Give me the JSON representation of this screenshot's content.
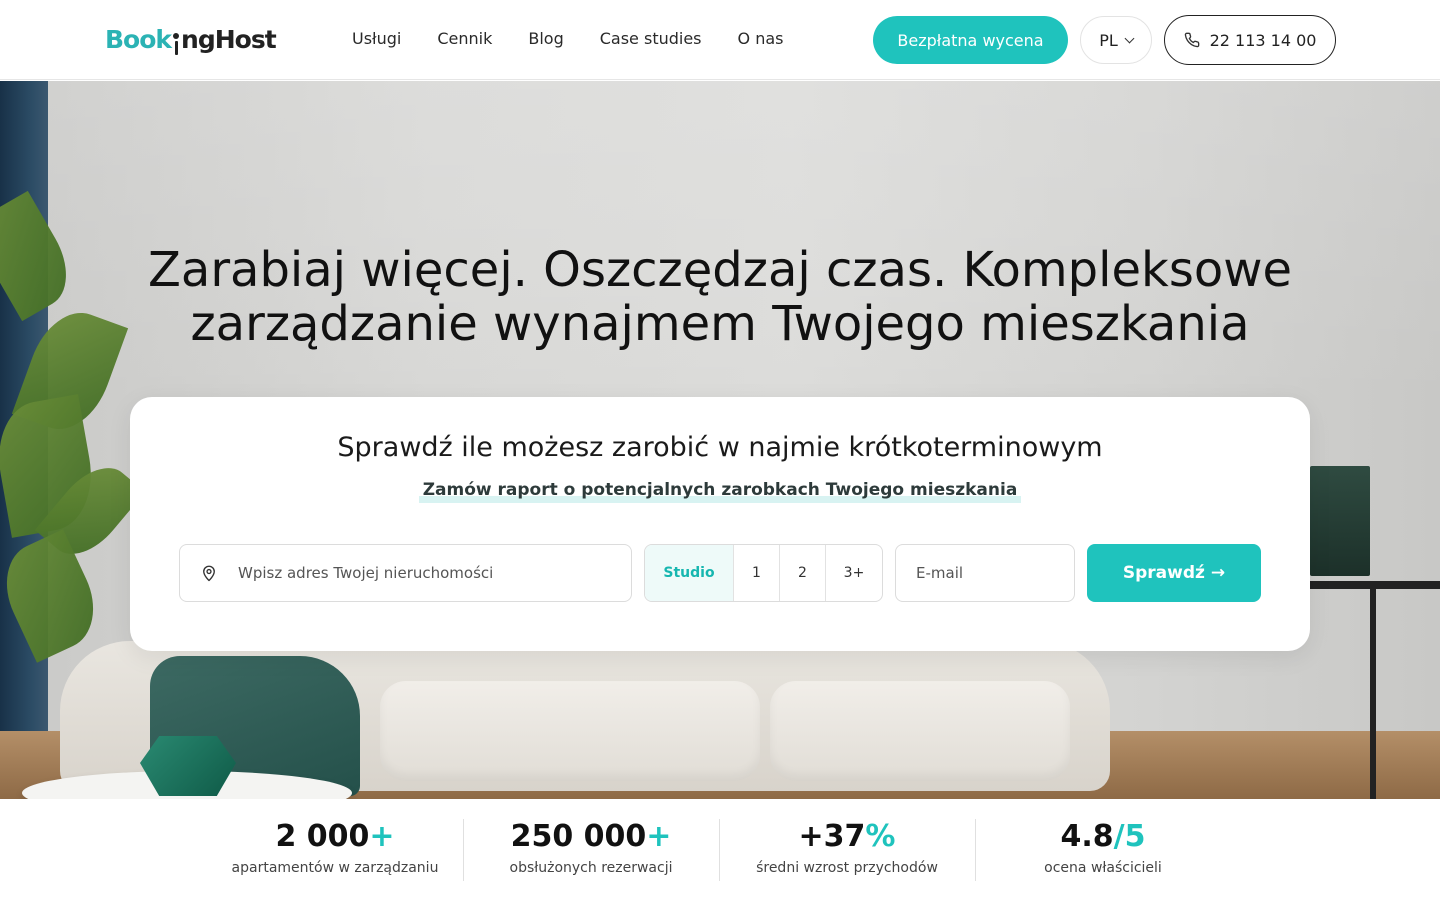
{
  "brand": {
    "logo_part1": "Book",
    "logo_part2": "ngHost",
    "colors": {
      "accent": "#1fc3bd",
      "text": "#1a1a1a"
    }
  },
  "nav": {
    "items": [
      "Usługi",
      "Cennik",
      "Blog",
      "Case studies",
      "O nas"
    ]
  },
  "header": {
    "cta_label": "Bezpłatna wycena",
    "language": "PL",
    "phone": "22 113 14 00",
    "icons": {
      "phone": "phone-icon",
      "language": "chevron-down-icon"
    }
  },
  "hero": {
    "title": "Zarabiaj więcej. Oszczędzaj czas. Kompleksowe zarządzanie wynajmem Twojego mieszkania"
  },
  "calculator": {
    "title": "Sprawdź ile możesz zarobić w najmie krótkoterminowym",
    "subtitle": "Zamów raport o potencjalnych zarobkach Twojego mieszkania",
    "address_placeholder": "Wpisz adres Twojej nieruchomości",
    "rooms": [
      "Studio",
      "1",
      "2",
      "3+"
    ],
    "selected_room": "Studio",
    "email_placeholder": "E-mail",
    "submit_label": "Sprawdź →",
    "icons": {
      "address": "location-pin-icon"
    }
  },
  "stats": [
    {
      "value": "2 000",
      "accent": "+",
      "label": "apartamentów w zarządzaniu"
    },
    {
      "value": "250 000",
      "accent": "+",
      "label": "obsłużonych rezerwacji"
    },
    {
      "value": "+37",
      "accent": "%",
      "label": "średni wzrost przychodów"
    },
    {
      "value": "4.8",
      "accent": "/5",
      "label": "ocena właścicieli"
    }
  ]
}
